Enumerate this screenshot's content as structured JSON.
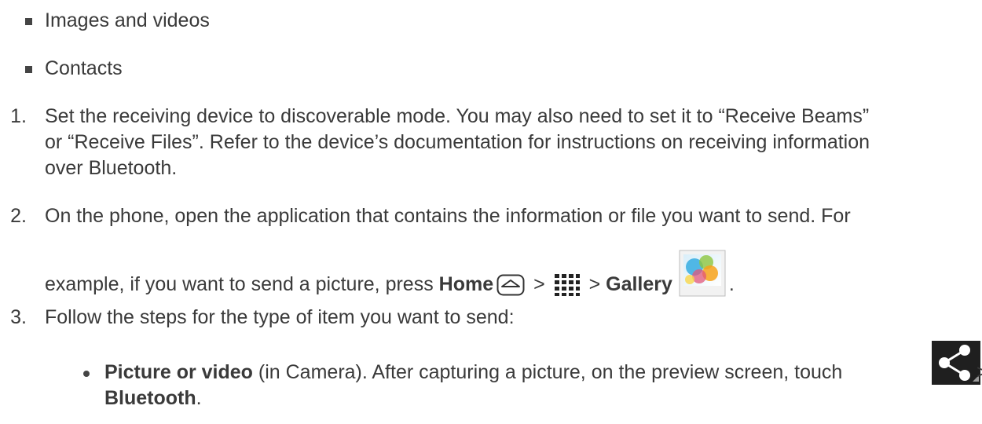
{
  "bullets": [
    {
      "text": "Images and videos"
    },
    {
      "text": "Contacts"
    }
  ],
  "steps": [
    {
      "num": "1.",
      "line1": "Set the receiving device to discoverable mode. You may also need to set it to “Receive Beams”",
      "line2": "or “Receive Files”. Refer to the device’s documentation for instructions on receiving information",
      "line3": "over Bluetooth."
    },
    {
      "num": "2.",
      "line1": "On the phone, open the application that contains the information or file you want to send. For",
      "line2_prefix": "example, if you want to send a picture, press ",
      "home_label": "Home",
      "sep1": " > ",
      "sep2": " > ",
      "gallery_label": "Gallery",
      "end": "."
    },
    {
      "num": "3.",
      "line1": "Follow the steps for the type of item you want to send:"
    }
  ],
  "sub_bullet": {
    "bold_label": "Picture or video",
    "text": " (in Camera). After capturing a picture, on the preview screen, touch ",
    "sep": " >",
    "bold_tail": "Bluetooth",
    "end": "."
  },
  "icons": {
    "home": "home-key-icon",
    "apps": "apps-grid-icon",
    "gallery": "gallery-app-icon",
    "share": "share-icon"
  },
  "colors": {
    "text": "#3a3a3a",
    "share_bg": "#222222"
  }
}
